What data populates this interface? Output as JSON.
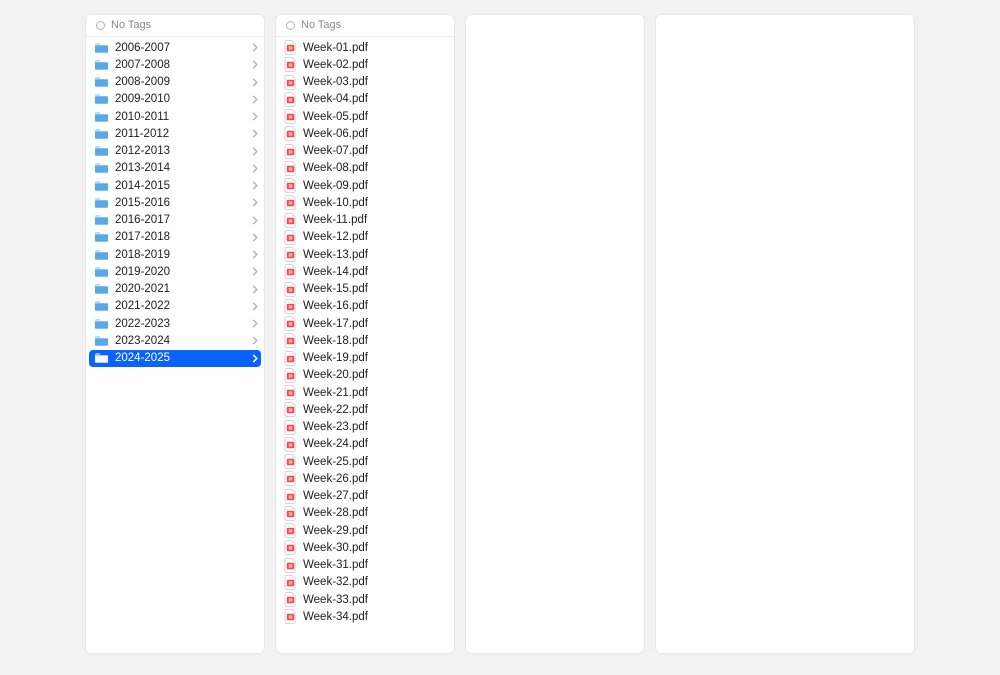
{
  "header": {
    "noTags": "No Tags"
  },
  "col1": {
    "selectedIndex": 18,
    "items": [
      {
        "name": "2006-2007"
      },
      {
        "name": "2007-2008"
      },
      {
        "name": "2008-2009"
      },
      {
        "name": "2009-2010"
      },
      {
        "name": "2010-2011"
      },
      {
        "name": "2011-2012"
      },
      {
        "name": "2012-2013"
      },
      {
        "name": "2013-2014"
      },
      {
        "name": "2014-2015"
      },
      {
        "name": "2015-2016"
      },
      {
        "name": "2016-2017"
      },
      {
        "name": "2017-2018"
      },
      {
        "name": "2018-2019"
      },
      {
        "name": "2019-2020"
      },
      {
        "name": "2020-2021"
      },
      {
        "name": "2021-2022"
      },
      {
        "name": "2022-2023"
      },
      {
        "name": "2023-2024"
      },
      {
        "name": "2024-2025"
      }
    ]
  },
  "col2": {
    "items": [
      {
        "name": "Week-01.pdf"
      },
      {
        "name": "Week-02.pdf"
      },
      {
        "name": "Week-03.pdf"
      },
      {
        "name": "Week-04.pdf"
      },
      {
        "name": "Week-05.pdf"
      },
      {
        "name": "Week-06.pdf"
      },
      {
        "name": "Week-07.pdf"
      },
      {
        "name": "Week-08.pdf"
      },
      {
        "name": "Week-09.pdf"
      },
      {
        "name": "Week-10.pdf"
      },
      {
        "name": "Week-11.pdf"
      },
      {
        "name": "Week-12.pdf"
      },
      {
        "name": "Week-13.pdf"
      },
      {
        "name": "Week-14.pdf"
      },
      {
        "name": "Week-15.pdf"
      },
      {
        "name": "Week-16.pdf"
      },
      {
        "name": "Week-17.pdf"
      },
      {
        "name": "Week-18.pdf"
      },
      {
        "name": "Week-19.pdf"
      },
      {
        "name": "Week-20.pdf"
      },
      {
        "name": "Week-21.pdf"
      },
      {
        "name": "Week-22.pdf"
      },
      {
        "name": "Week-23.pdf"
      },
      {
        "name": "Week-24.pdf"
      },
      {
        "name": "Week-25.pdf"
      },
      {
        "name": "Week-26.pdf"
      },
      {
        "name": "Week-27.pdf"
      },
      {
        "name": "Week-28.pdf"
      },
      {
        "name": "Week-29.pdf"
      },
      {
        "name": "Week-30.pdf"
      },
      {
        "name": "Week-31.pdf"
      },
      {
        "name": "Week-32.pdf"
      },
      {
        "name": "Week-33.pdf"
      },
      {
        "name": "Week-34.pdf"
      }
    ]
  }
}
